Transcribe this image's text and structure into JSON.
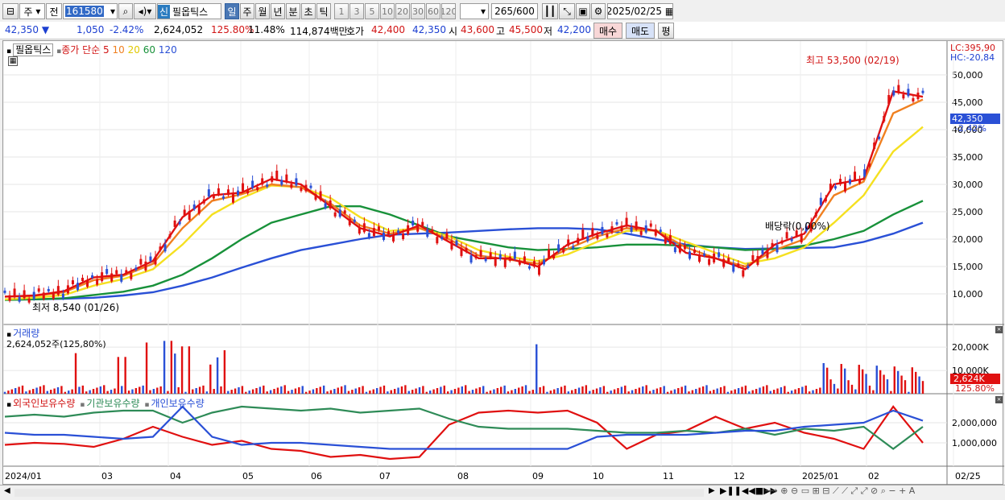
{
  "toolbar": {
    "market": "주",
    "prev": "전",
    "code": "161580",
    "new_badge": "신",
    "name": "필옵틱스",
    "periods": [
      "일",
      "주",
      "월",
      "년",
      "분",
      "초",
      "틱"
    ],
    "intervals": [
      "1",
      "3",
      "5",
      "10",
      "20",
      "30",
      "60",
      "120"
    ],
    "count": "265",
    "total": "/600",
    "date": "2025/02/25"
  },
  "quote": {
    "price": "42,350",
    "dir": "▼",
    "change": "1,050",
    "rate": "-2.42%",
    "volume": "2,624,052",
    "vol_rate": "125.80%",
    "turnover": "11.48%",
    "amount": "114,874백만",
    "ask_label": "호가",
    "ask": "42,400",
    "bid": "42,350",
    "open_label": "시",
    "open": "43,600",
    "high_label": "고",
    "high": "45,500",
    "low_label": "저",
    "low": "42,200",
    "buy": "매수",
    "sell": "매도",
    "eval": "평"
  },
  "legend": {
    "name": "필옵틱스",
    "ma_label": "종가 단순",
    "mas": [
      "5",
      "10",
      "20",
      "60",
      "120"
    ]
  },
  "chart_data": [
    {
      "type": "line",
      "title": "필옵틱스",
      "ylim": [
        5000,
        55000
      ],
      "yticks": [
        "10,000",
        "15,000",
        "20,000",
        "25,000",
        "30,000",
        "35,000",
        "40,000",
        "45,000",
        "50,000"
      ],
      "x": [
        "2024/01",
        "03",
        "04",
        "05",
        "06",
        "07",
        "08",
        "09",
        "10",
        "11",
        "12",
        "2025/01",
        "02",
        "02/25"
      ],
      "last_label": "42,350",
      "last_rate": "-2.42%",
      "lc": "LC:395,90",
      "hc": "HC:-20,84",
      "high_note": "최고 53,500 (02/19)",
      "low_note": "최저 8,540 (01/26)",
      "div_note": "배당락(0,00%)",
      "series": [
        {
          "name": "5",
          "color": "#e01010",
          "values": [
            9500,
            9700,
            10500,
            13000,
            13500,
            16000,
            24000,
            28000,
            28500,
            31000,
            30000,
            26000,
            22000,
            20500,
            22500,
            19500,
            16500,
            16500,
            15000,
            19000,
            21000,
            22500,
            21500,
            17500,
            16500,
            14500,
            19000,
            21000,
            30000,
            31000,
            47000,
            46000
          ]
        },
        {
          "name": "10",
          "color": "#f08020",
          "values": [
            9500,
            9650,
            10300,
            12500,
            13300,
            15500,
            22000,
            27000,
            28200,
            30000,
            29500,
            26500,
            22500,
            21000,
            22000,
            20000,
            17000,
            16300,
            15500,
            18200,
            20500,
            22000,
            21500,
            18500,
            16500,
            15000,
            18000,
            20000,
            28000,
            30500,
            43000,
            45500
          ]
        },
        {
          "name": "20",
          "color": "#f5e020",
          "values": [
            9000,
            9300,
            9800,
            11500,
            12700,
            14500,
            19000,
            24500,
            27500,
            29800,
            29500,
            27500,
            24000,
            21500,
            22000,
            20500,
            18000,
            16800,
            16000,
            17200,
            19500,
            21500,
            21600,
            19500,
            17500,
            15500,
            16500,
            18500,
            23000,
            28000,
            36000,
            40500
          ]
        },
        {
          "name": "60",
          "color": "#18913a",
          "values": [
            8900,
            9000,
            9200,
            9800,
            10400,
            11500,
            13500,
            16500,
            20000,
            23000,
            24500,
            26000,
            26000,
            24500,
            22500,
            20500,
            19500,
            18500,
            18000,
            18200,
            18500,
            19000,
            19000,
            18800,
            18500,
            18000,
            18200,
            18800,
            20000,
            21500,
            24500,
            27000
          ]
        },
        {
          "name": "120",
          "color": "#2a50d6",
          "values": [
            9000,
            9000,
            9100,
            9300,
            9700,
            10300,
            11500,
            13000,
            14800,
            16500,
            18000,
            19000,
            20000,
            20800,
            21000,
            21200,
            21500,
            21800,
            22000,
            22000,
            21800,
            21000,
            20000,
            19000,
            18500,
            18200,
            18300,
            18400,
            18500,
            19500,
            21000,
            23000
          ]
        }
      ]
    },
    {
      "type": "bar",
      "title": "거래량",
      "ylim": [
        0,
        28000
      ],
      "yticks": [
        "10,000K",
        "20,000K"
      ],
      "last_label": "2,624K",
      "last_rate": "125.80%",
      "value_note": "2,624,052주(125,80%)"
    },
    {
      "type": "line",
      "title": "외국인보유수량",
      "ylim": [
        0,
        3000000
      ],
      "yticks": [
        "1,000,000",
        "2,000,000"
      ],
      "series": [
        {
          "name": "외국인보유수량",
          "color": "#e01010",
          "values": [
            900000,
            1000000,
            950000,
            800000,
            1200000,
            1800000,
            1300000,
            900000,
            1100000,
            700000,
            600000,
            300000,
            400000,
            200000,
            300000,
            1900000,
            2500000,
            2600000,
            2500000,
            2600000,
            2000000,
            700000,
            1400000,
            1600000,
            2300000,
            1700000,
            2000000,
            1500000,
            1200000,
            700000,
            2800000,
            1000000
          ]
        },
        {
          "name": "기관보유수량",
          "color": "#2e8b57",
          "values": [
            2300000,
            2400000,
            2300000,
            2500000,
            2600000,
            2600000,
            2000000,
            2500000,
            2800000,
            2700000,
            2600000,
            2700000,
            2500000,
            2600000,
            2700000,
            2200000,
            1800000,
            1700000,
            1700000,
            1700000,
            1600000,
            1500000,
            1500000,
            1600000,
            1500000,
            1700000,
            1400000,
            1700000,
            1600000,
            1800000,
            700000,
            1800000
          ]
        },
        {
          "name": "개인보유수량",
          "color": "#2a50d6",
          "values": [
            1500000,
            1400000,
            1400000,
            1300000,
            1200000,
            1300000,
            2800000,
            1300000,
            900000,
            1000000,
            1000000,
            900000,
            800000,
            700000,
            700000,
            700000,
            700000,
            700000,
            700000,
            700000,
            1300000,
            1400000,
            1400000,
            1400000,
            1500000,
            1600000,
            1600000,
            1800000,
            1900000,
            2000000,
            2600000,
            2100000
          ]
        }
      ]
    }
  ],
  "scroll": {
    "left": "◀",
    "right": "▶"
  }
}
